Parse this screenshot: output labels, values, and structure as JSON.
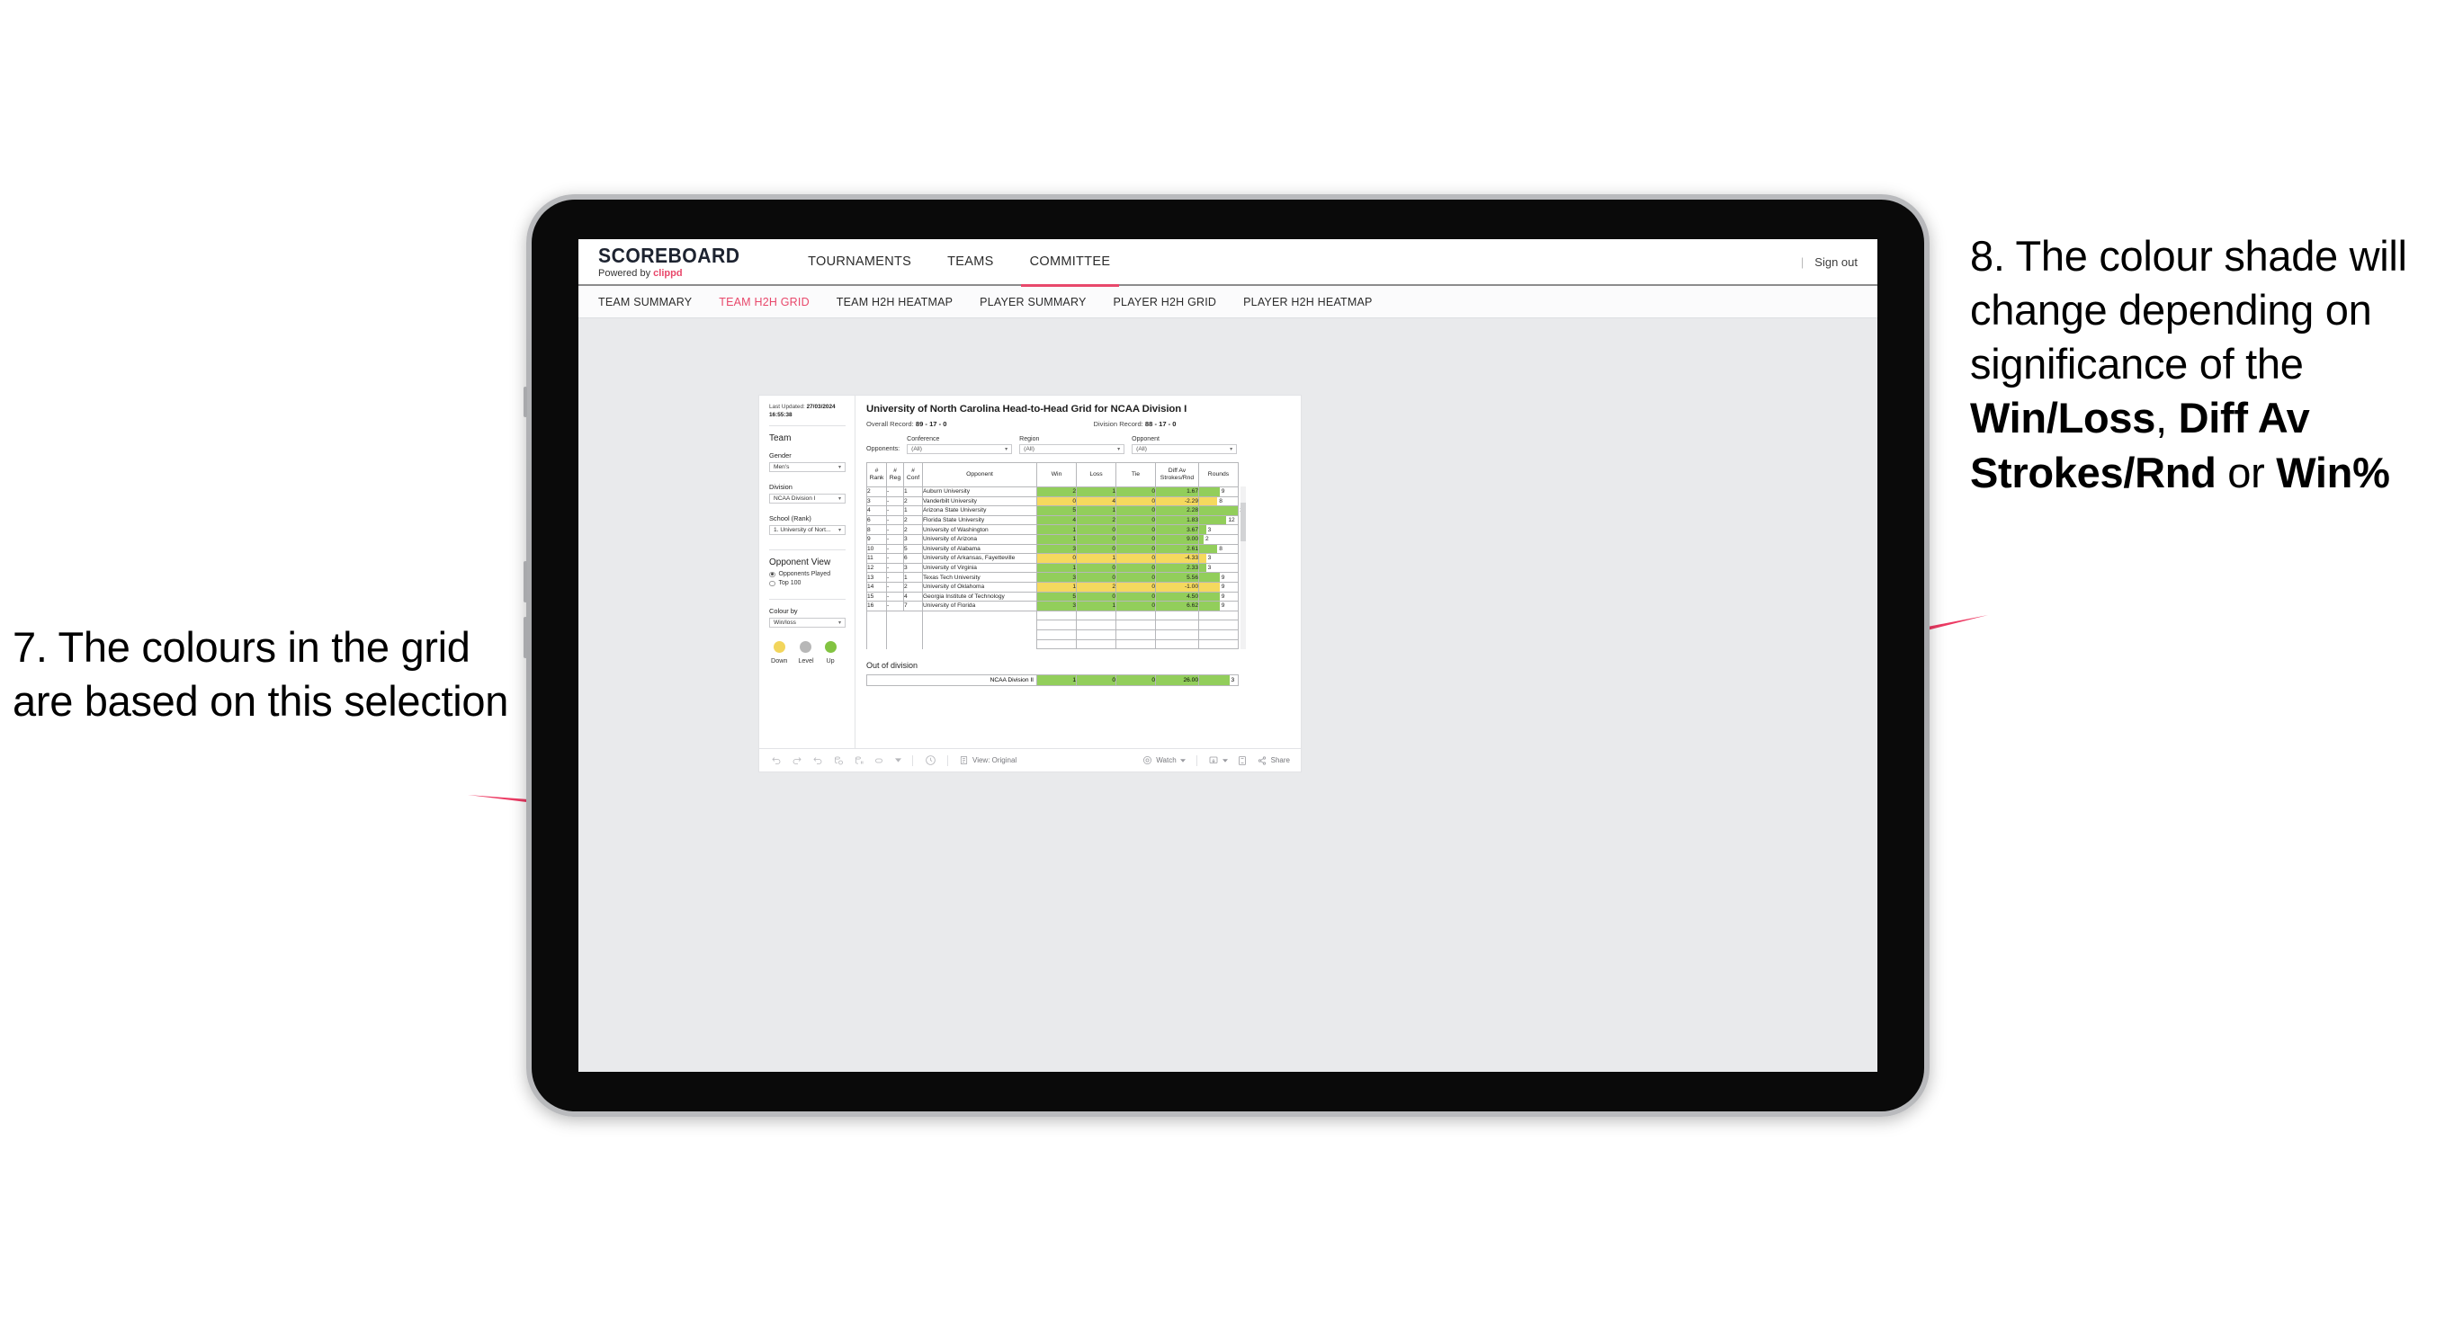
{
  "annotations": {
    "left": {
      "id": "7.",
      "text": "7. The colours in the grid are based on this selection"
    },
    "right": {
      "id": "8.",
      "part1": "8. The colour shade will change depending on significance of the ",
      "bold1": "Win/Loss",
      "mid1": ", ",
      "bold2": "Diff Av Strokes/Rnd",
      "mid2": " or ",
      "bold3": "Win%"
    },
    "arrow_color": "#ec3a63"
  },
  "app": {
    "brand": {
      "name": "SCOREBOARD",
      "powered_prefix": "Powered by ",
      "powered_brand": "clippd"
    },
    "topnav": [
      {
        "label": "TOURNAMENTS",
        "active": false
      },
      {
        "label": "TEAMS",
        "active": false
      },
      {
        "label": "COMMITTEE",
        "active": true
      }
    ],
    "signout": "Sign out",
    "subnav": [
      {
        "label": "TEAM SUMMARY",
        "active": false
      },
      {
        "label": "TEAM H2H GRID",
        "active": true
      },
      {
        "label": "TEAM H2H HEATMAP",
        "active": false
      },
      {
        "label": "PLAYER SUMMARY",
        "active": false
      },
      {
        "label": "PLAYER H2H GRID",
        "active": false
      },
      {
        "label": "PLAYER H2H HEATMAP",
        "active": false
      }
    ],
    "accent": "#e8486b"
  },
  "filters": {
    "last_updated_label": "Last Updated: ",
    "last_updated_value": "27/03/2024 16:55:38",
    "team_heading": "Team",
    "gender_label": "Gender",
    "gender_value": "Men's",
    "division_label": "Division",
    "division_value": "NCAA Division I",
    "school_label": "School (Rank)",
    "school_value": "1. University of Nort...",
    "opponent_view_heading": "Opponent View",
    "opponent_view_options": [
      {
        "label": "Opponents Played",
        "selected": true
      },
      {
        "label": "Top 100",
        "selected": false
      }
    ],
    "colour_by_label": "Colour by",
    "colour_by_value": "Win/loss",
    "legend": [
      {
        "label": "Down",
        "color": "#f2d55c"
      },
      {
        "label": "Level",
        "color": "#b7b7b7"
      },
      {
        "label": "Up",
        "color": "#82c341"
      }
    ]
  },
  "view": {
    "title": "University of North Carolina Head-to-Head Grid for NCAA Division I",
    "overall_record_label": "Overall Record: ",
    "overall_record_value": "89 - 17 - 0",
    "division_record_label": "Division Record: ",
    "division_record_value": "88 - 17 - 0",
    "opponents_label": "Opponents:",
    "dropdowns": [
      {
        "label": "Conference",
        "value": "(All)"
      },
      {
        "label": "Region",
        "value": "(All)"
      },
      {
        "label": "Opponent",
        "value": "(All)"
      }
    ],
    "out_of_division_title": "Out of division",
    "out_of_division_row": {
      "name": "NCAA Division II",
      "win": "1",
      "loss": "0",
      "tie": "0",
      "diff": "26.00",
      "rounds": "3",
      "color": "#92ce5b"
    }
  },
  "chart_data": {
    "type": "table",
    "title": "University of North Carolina Head-to-Head Grid for NCAA Division I",
    "columns": [
      "# Rank",
      "# Reg",
      "# Conf",
      "Opponent",
      "Win",
      "Loss",
      "Tie",
      "Diff Av Strokes/Rnd",
      "Rounds"
    ],
    "column_headers_multiline": [
      [
        "#",
        "Rank"
      ],
      [
        "#",
        "Reg"
      ],
      [
        "#",
        "Conf"
      ],
      [
        "Opponent"
      ],
      [
        "Win"
      ],
      [
        "Loss"
      ],
      [
        "Tie"
      ],
      [
        "Diff Av",
        "Strokes/Rnd"
      ],
      [
        "Rounds"
      ]
    ],
    "rounds_max": 17,
    "colors": {
      "up": "#92ce5b",
      "down": "#f5d95e",
      "level": "#b7b7b7"
    },
    "rows": [
      {
        "rank": "2",
        "reg": "-",
        "conf": "1",
        "opponent": "Auburn University",
        "win": "2",
        "loss": "1",
        "tie": "0",
        "diff": "1.67",
        "rounds": "9",
        "tone": "up"
      },
      {
        "rank": "3",
        "reg": "-",
        "conf": "2",
        "opponent": "Vanderbilt University",
        "win": "0",
        "loss": "4",
        "tie": "0",
        "diff": "-2.29",
        "rounds": "8",
        "tone": "down"
      },
      {
        "rank": "4",
        "reg": "-",
        "conf": "1",
        "opponent": "Arizona State University",
        "win": "5",
        "loss": "1",
        "tie": "0",
        "diff": "2.28",
        "rounds": "17",
        "tone": "up"
      },
      {
        "rank": "6",
        "reg": "-",
        "conf": "2",
        "opponent": "Florida State University",
        "win": "4",
        "loss": "2",
        "tie": "0",
        "diff": "1.83",
        "rounds": "12",
        "tone": "up"
      },
      {
        "rank": "8",
        "reg": "-",
        "conf": "2",
        "opponent": "University of Washington",
        "win": "1",
        "loss": "0",
        "tie": "0",
        "diff": "3.67",
        "rounds": "3",
        "tone": "up"
      },
      {
        "rank": "9",
        "reg": "-",
        "conf": "3",
        "opponent": "University of Arizona",
        "win": "1",
        "loss": "0",
        "tie": "0",
        "diff": "9.00",
        "rounds": "2",
        "tone": "up"
      },
      {
        "rank": "10",
        "reg": "-",
        "conf": "5",
        "opponent": "University of Alabama",
        "win": "3",
        "loss": "0",
        "tie": "0",
        "diff": "2.61",
        "rounds": "8",
        "tone": "up"
      },
      {
        "rank": "11",
        "reg": "-",
        "conf": "6",
        "opponent": "University of Arkansas, Fayetteville",
        "win": "0",
        "loss": "1",
        "tie": "0",
        "diff": "-4.33",
        "rounds": "3",
        "tone": "down"
      },
      {
        "rank": "12",
        "reg": "-",
        "conf": "3",
        "opponent": "University of Virginia",
        "win": "1",
        "loss": "0",
        "tie": "0",
        "diff": "2.33",
        "rounds": "3",
        "tone": "up"
      },
      {
        "rank": "13",
        "reg": "-",
        "conf": "1",
        "opponent": "Texas Tech University",
        "win": "3",
        "loss": "0",
        "tie": "0",
        "diff": "5.56",
        "rounds": "9",
        "tone": "up"
      },
      {
        "rank": "14",
        "reg": "-",
        "conf": "2",
        "opponent": "University of Oklahoma",
        "win": "1",
        "loss": "2",
        "tie": "0",
        "diff": "-1.00",
        "rounds": "9",
        "tone": "down"
      },
      {
        "rank": "15",
        "reg": "-",
        "conf": "4",
        "opponent": "Georgia Institute of Technology",
        "win": "5",
        "loss": "0",
        "tie": "0",
        "diff": "4.50",
        "rounds": "9",
        "tone": "up"
      },
      {
        "rank": "16",
        "reg": "-",
        "conf": "7",
        "opponent": "University of Florida",
        "win": "3",
        "loss": "1",
        "tie": "0",
        "diff": "6.62",
        "rounds": "9",
        "tone": "up"
      }
    ]
  },
  "toolbar": {
    "view_label": "View: Original",
    "watch_label": "Watch",
    "share_label": "Share"
  }
}
